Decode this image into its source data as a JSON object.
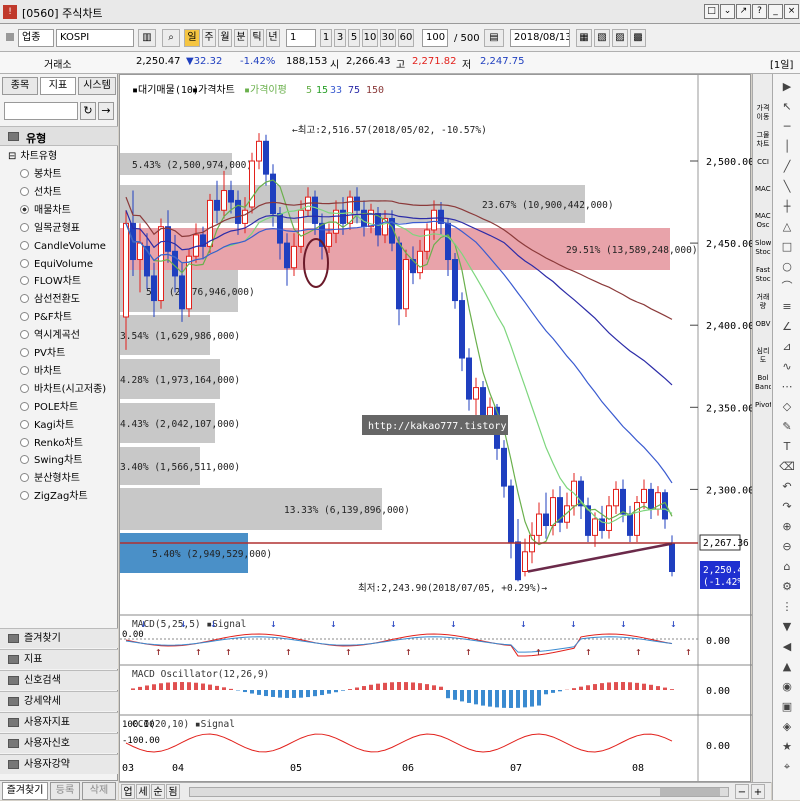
{
  "window": {
    "title": "[0560] 주식차트",
    "buttons": [
      "□",
      "⌄",
      "↗",
      "?",
      "_",
      "□",
      "×"
    ]
  },
  "toolbar": {
    "category": "업종",
    "symbol": "KOSPI",
    "periods": [
      "주",
      "월",
      "분",
      "틱",
      "년"
    ],
    "unit": "1",
    "intervals": [
      "1",
      "3",
      "5",
      "10",
      "30",
      "60"
    ],
    "count": "100",
    "total": "/ 500",
    "date": "2018/08/13"
  },
  "quote": {
    "label": "거래소",
    "price": "2,250.47",
    "change": "▼32.32",
    "pct": "-1.42%",
    "volume": "188,153",
    "open_label": "시",
    "open": "2,266.43",
    "high_label": "고",
    "high": "2,271.82",
    "low_label": "저",
    "low": "2,247.75",
    "period": "[1일]"
  },
  "left": {
    "tabs": [
      "종목",
      "지표",
      "시스템"
    ],
    "section": "유형",
    "group": "차트유형",
    "types": [
      "봉차트",
      "선차트",
      "매물차트",
      "일목균형표",
      "CandleVolume",
      "EquiVolume",
      "FLOW차트",
      "삼선전환도",
      "P&F차트",
      "역시계곡선",
      "PV차트",
      "바차트",
      "바차트(시고저종)",
      "POLE차트",
      "Kagi차트",
      "Renko차트",
      "Swing차트",
      "분산형차트",
      "ZigZag차트"
    ],
    "selected_type": "매물차트",
    "accordion": [
      "즐겨찾기",
      "지표",
      "신호검색",
      "강세약세",
      "사용자지표",
      "사용자신호",
      "사용자강약"
    ],
    "bottom_tabs": [
      "즐겨찾기",
      "등록",
      "삭제"
    ]
  },
  "chart": {
    "legend": {
      "title": "대기매물(10)",
      "price": "가격차트",
      "ma_label": "가격이평",
      "ma": [
        "5",
        "15",
        "33",
        "75",
        "150"
      ]
    },
    "price_ticks": [
      "2,500.00",
      "2,450.00",
      "2,400.00",
      "2,350.00",
      "2,300.00"
    ],
    "date_ticks": [
      "03",
      "04",
      "05",
      "06",
      "07",
      "08"
    ],
    "max_note": "←최고:2,516.57(2018/05/02, -10.57%)",
    "min_note": "최저:2,243.90(2018/07/05, +0.29%)→",
    "watermark": "http://kakao777.tistory.com",
    "current_level": "2,267.36",
    "last_price": "2,250.47",
    "last_pct": "(-1.42%)",
    "volume_labels": [
      "5.43% (2,500,974,000)",
      "23.67% (10,900,442,000)",
      "29.51% (13,589,248,000)",
      "5.8 (2,676,946,000)",
      "3.54% (1,629,986,000)",
      "4.28% (1,973,164,000)",
      "4.43% (2,042,107,000)",
      "3.40% (1,566,511,000)",
      "13.33% (6,139,896,000)",
      "5.40% (2,949,529,000)"
    ],
    "indicators": [
      {
        "title": "MACD(5,25,5)",
        "signal": "Signal",
        "value": "0.00",
        "top": "0.00"
      },
      {
        "title": "MACD Oscillator(12,26,9)",
        "value": "0.00"
      },
      {
        "title": "CCI(20,10)",
        "signal": "Signal",
        "value": "0.00",
        "top": "100.00",
        "bottom": "-100.00"
      }
    ]
  },
  "right": {
    "tools": [
      "가격이동",
      "그물차트",
      "CCI",
      "MACD",
      "MACD Osc",
      "Slow Stoc",
      "Fast Stoc",
      "거래량",
      "OBV",
      "심리도",
      "Bol Band",
      "Pivot"
    ]
  },
  "bottom": {
    "buttons": [
      "업",
      "세",
      "순",
      "됨"
    ]
  },
  "colors": {
    "up": "#e2211c",
    "down": "#1f3fbf",
    "volume_gray": "#c8c8c8",
    "volume_red": "#e8a3aa",
    "volume_blue": "#4a90c8"
  }
}
